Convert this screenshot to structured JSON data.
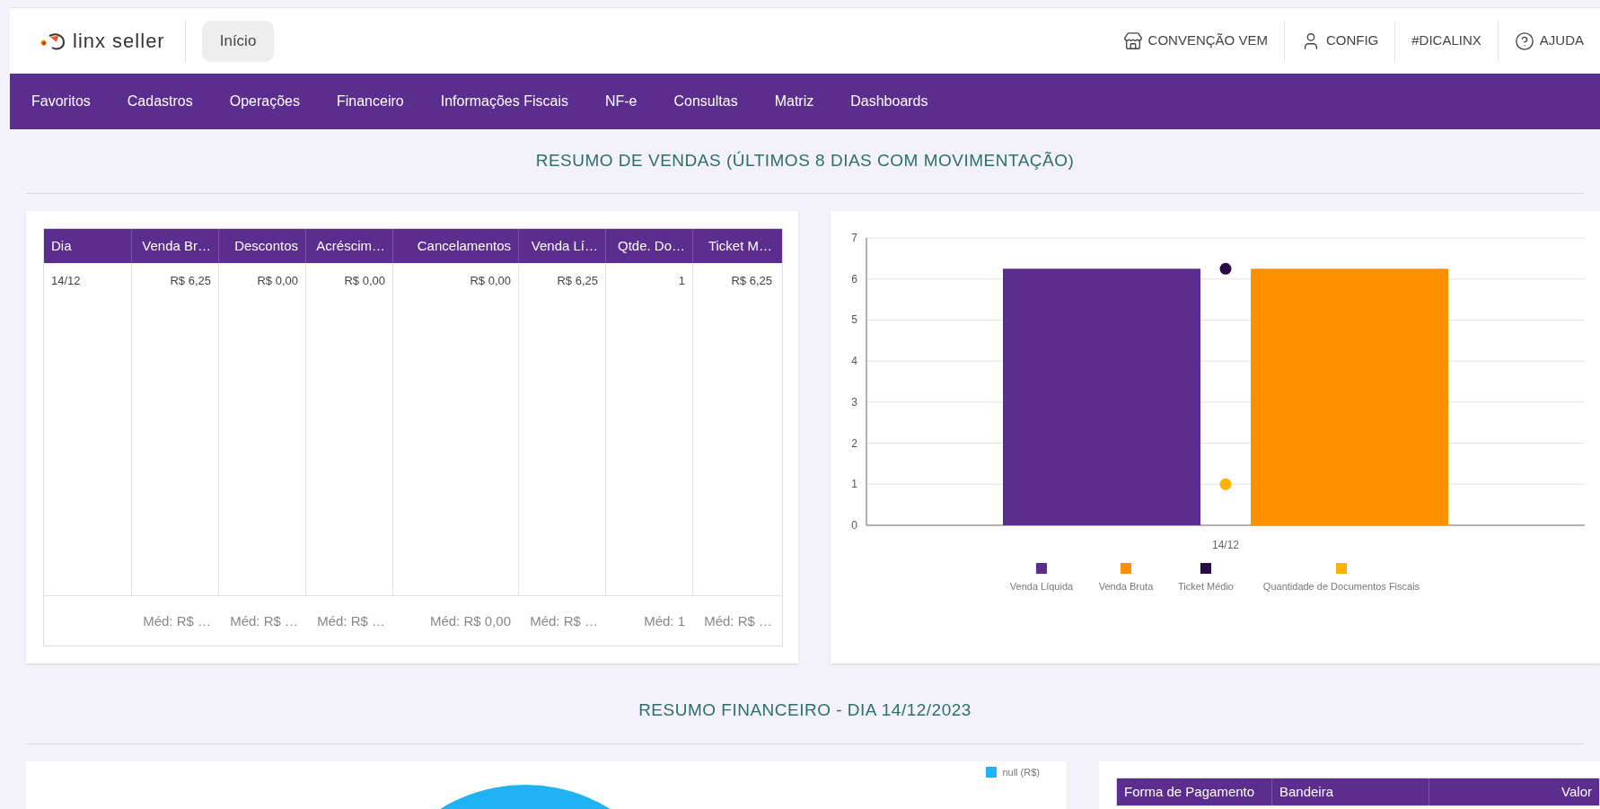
{
  "header": {
    "logo_text": "linx seller",
    "home_button": "Início",
    "links": [
      {
        "kind": "store",
        "label": "CONVENÇÃO VEM"
      },
      {
        "kind": "user",
        "label": "CONFIG"
      },
      {
        "kind": "plain",
        "label": "#DICALINX"
      },
      {
        "kind": "help",
        "label": "AJUDA"
      }
    ]
  },
  "nav": [
    "Favoritos",
    "Cadastros",
    "Operações",
    "Financeiro",
    "Informações Fiscais",
    "NF-e",
    "Consultas",
    "Matriz",
    "Dashboards"
  ],
  "sales_section": {
    "title": "RESUMO DE VENDAS (ÚLTIMOS 8 DIAS COM MOVIMENTAÇÃO)",
    "table": {
      "columns": [
        "Dia",
        "Venda Br…",
        "Descontos",
        "Acréscim…",
        "Cancelamentos",
        "Venda Lí…",
        "Qtde. Do…",
        "Ticket M…"
      ],
      "rows": [
        [
          "14/12",
          "R$ 6,25",
          "R$ 0,00",
          "R$ 0,00",
          "R$ 0,00",
          "R$ 6,25",
          "1",
          "R$ 6,25"
        ]
      ],
      "footer": [
        "Méd: R$ …",
        "Méd: R$ …",
        "Méd: R$ …",
        "Méd: R$ 0,00",
        "Méd: R$ …",
        "Méd: 1",
        "Méd: R$ …"
      ]
    },
    "chart_data": {
      "type": "bar",
      "categories": [
        "14/12"
      ],
      "ylim": [
        0,
        7
      ],
      "yticks": [
        0,
        1,
        2,
        3,
        4,
        5,
        6,
        7
      ],
      "grid": true,
      "legend": "bottom",
      "series": [
        {
          "name": "Venda Líquida",
          "color": "#5b2d8e",
          "type": "bar",
          "values": [
            6.25
          ]
        },
        {
          "name": "Venda Bruta",
          "color": "#ff9100",
          "type": "bar",
          "values": [
            6.25
          ]
        },
        {
          "name": "Ticket Médio",
          "color": "#2a0a45",
          "type": "scatter",
          "values": [
            6.25
          ]
        },
        {
          "name": "Quantidade de Documentos Fiscais",
          "color": "#ffb300",
          "type": "scatter",
          "values": [
            1
          ]
        }
      ]
    }
  },
  "finance_section": {
    "title": "RESUMO FINANCEIRO - DIA 14/12/2023",
    "pie_legend": [
      {
        "label": "null (R$)",
        "color": "#1fb2f5"
      }
    ],
    "payments_table": {
      "columns": [
        "Forma de Pagamento",
        "Bandeira",
        "Valor"
      ]
    }
  }
}
